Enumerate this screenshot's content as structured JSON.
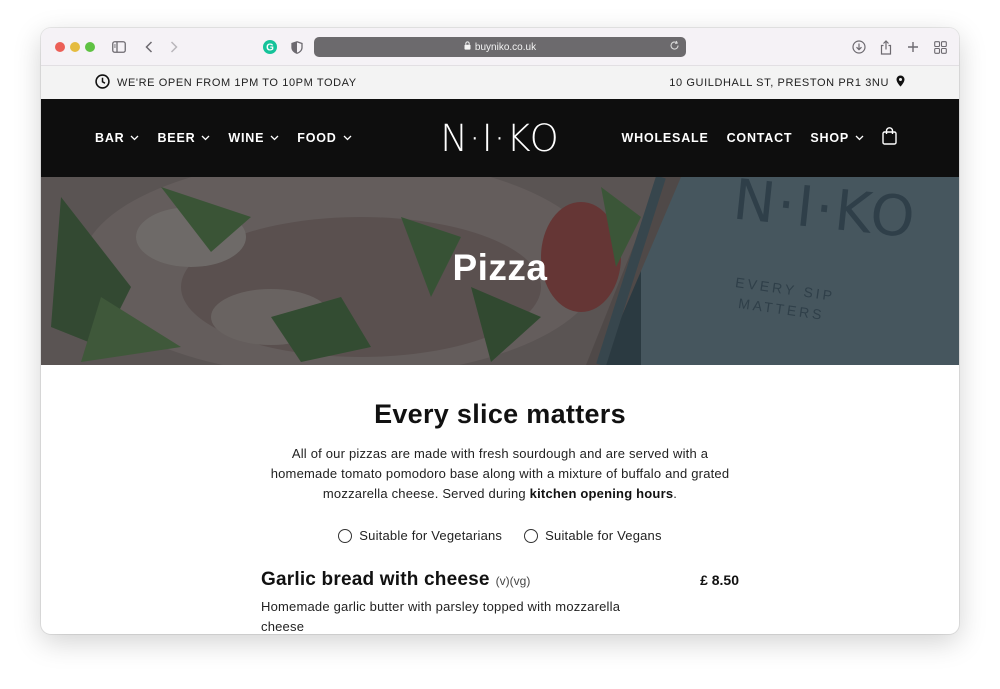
{
  "browser": {
    "url": "buyniko.co.uk"
  },
  "infobar": {
    "hours": "WE'RE OPEN FROM 1PM TO 10PM TODAY",
    "address": "10 GUILDHALL ST, PRESTON PR1 3NU"
  },
  "nav": {
    "logo": "N·I·KO",
    "left": [
      {
        "label": "BAR"
      },
      {
        "label": "BEER"
      },
      {
        "label": "WINE"
      },
      {
        "label": "FOOD"
      }
    ],
    "right": {
      "wholesale": "WHOLESALE",
      "contact": "CONTACT",
      "shop": "SHOP"
    }
  },
  "hero": {
    "title": "Pizza",
    "box_text_1": "N·I·KO",
    "box_text_2": "EVERY SIP",
    "box_text_3": "MATTERS"
  },
  "main": {
    "heading": "Every slice matters",
    "intro_text": "All of our pizzas are made with fresh sourdough and are served with a homemade tomato pomodoro base along with a mixture of buffalo and grated mozzarella cheese. Served during ",
    "intro_link": "kitchen opening hours",
    "intro_end": ".",
    "filters": {
      "vegetarian": "Suitable for Vegetarians",
      "vegan": "Suitable for Vegans"
    },
    "items": [
      {
        "name": "Garlic bread with cheese",
        "tags": "(v)(vg)",
        "price": "£ 8.50",
        "description": "Homemade garlic butter with parsley topped with mozzarella cheese"
      }
    ]
  },
  "colors": {
    "nav_bg": "#0e0e0e",
    "infobar_bg": "#f3f3f3",
    "text": "#111111"
  }
}
